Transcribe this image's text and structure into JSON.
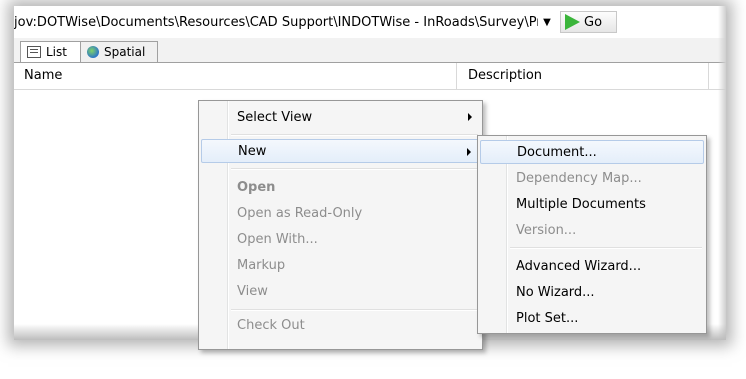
{
  "address_bar": {
    "path": "jov:DOTWise\\Documents\\Resources\\CAD Support\\INDOTWise - InRoads\\Survey\\Proje",
    "go_label": "Go"
  },
  "tabs": [
    {
      "label": "List"
    },
    {
      "label": "Spatial"
    }
  ],
  "columns": {
    "name": "Name",
    "description": "Description"
  },
  "context_menu": {
    "items": [
      {
        "label": "Select View",
        "submenu": true
      },
      {
        "label": "New",
        "submenu": true,
        "highlighted": true
      },
      {
        "label": "Open",
        "disabled": true,
        "bold": true
      },
      {
        "label": "Open as Read-Only",
        "disabled": true
      },
      {
        "label": "Open With...",
        "disabled": true
      },
      {
        "label": "Markup",
        "disabled": true
      },
      {
        "label": "View",
        "disabled": true
      },
      {
        "label": "Check Out",
        "disabled": true
      }
    ]
  },
  "submenu_new": {
    "items": [
      {
        "label": "Document...",
        "highlighted": true
      },
      {
        "label": "Dependency Map...",
        "disabled": true
      },
      {
        "label": "Multiple Documents"
      },
      {
        "label": "Version...",
        "disabled": true
      },
      {
        "label": "Advanced Wizard..."
      },
      {
        "label": "No Wizard..."
      },
      {
        "label": "Plot Set..."
      }
    ]
  },
  "colors": {
    "go_arrow": "#3ab53a",
    "highlight_border": "#b5cbe8",
    "disabled_text": "#8d8d8d"
  }
}
